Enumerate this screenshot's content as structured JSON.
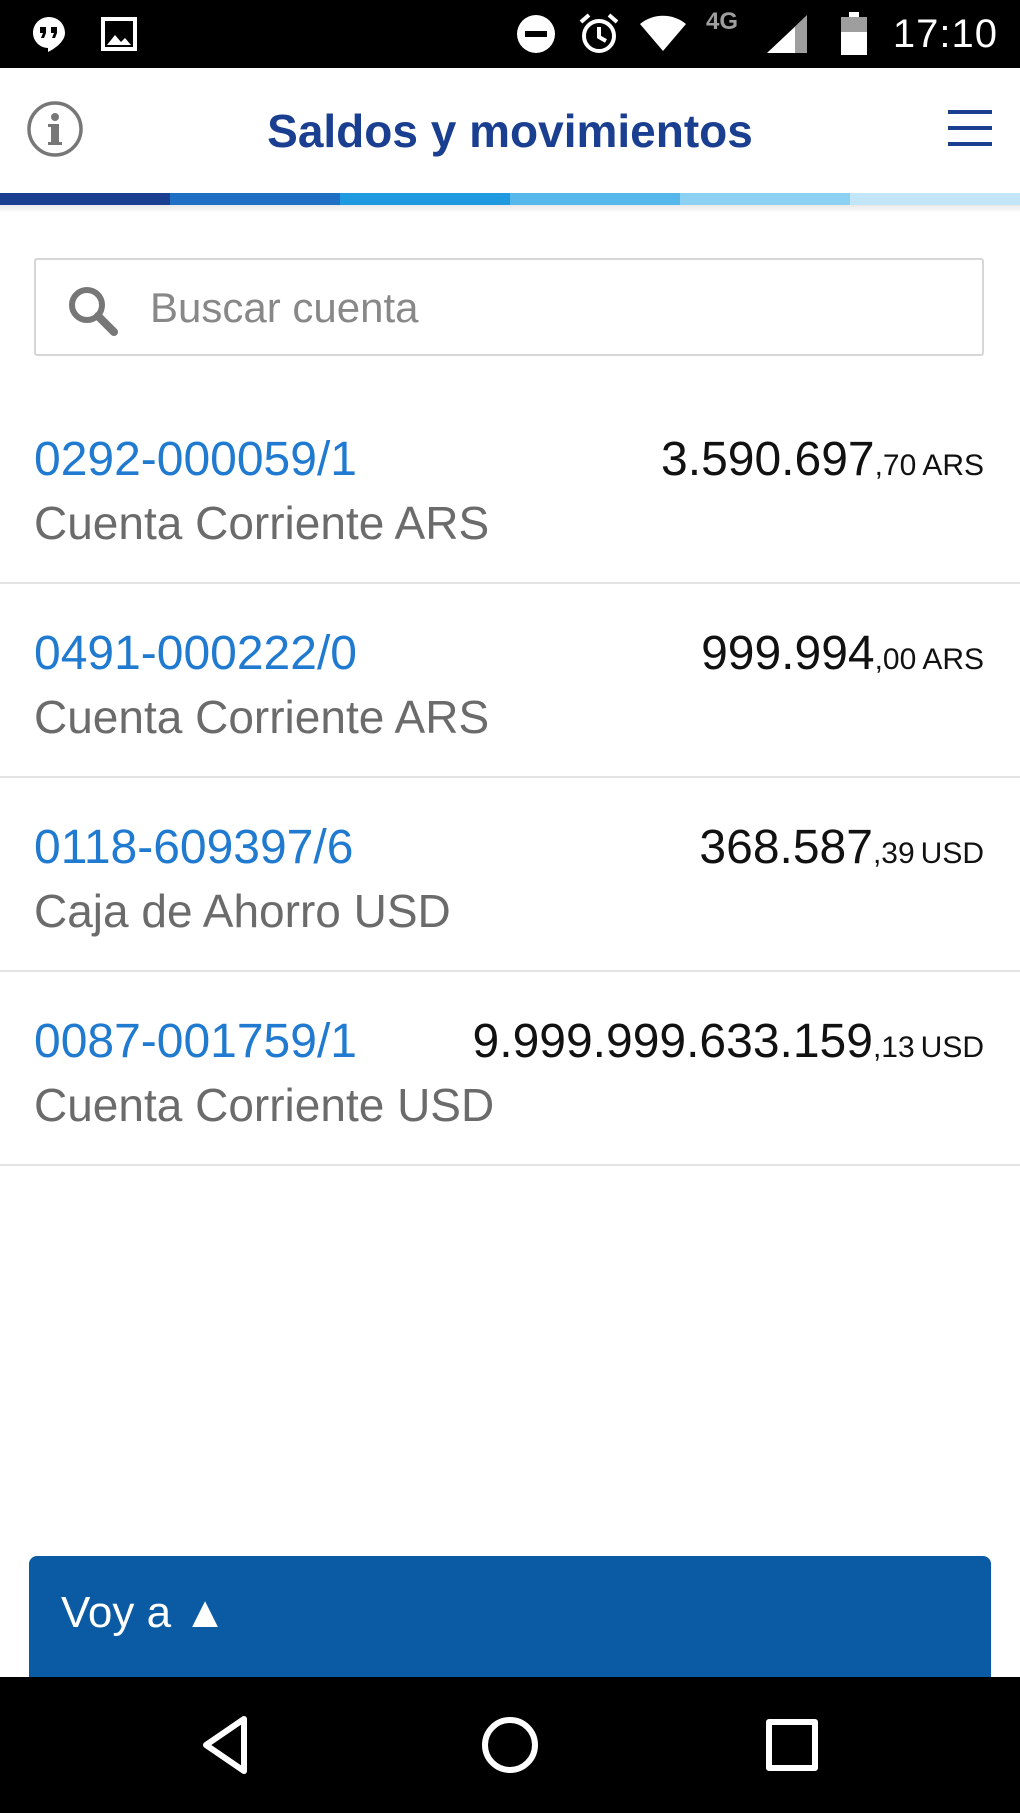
{
  "status_bar": {
    "time": "17:10",
    "network": "4G",
    "icons": [
      "hangouts-icon",
      "image-icon",
      "do-not-disturb-icon",
      "alarm-icon",
      "wifi-icon",
      "signal-icon",
      "battery-icon"
    ]
  },
  "header": {
    "title": "Saldos y movimientos",
    "info_icon": "info-icon",
    "menu_icon": "menu-icon",
    "stripe_colors": [
      "#1a3f91",
      "#1f6fc4",
      "#1f9ae0",
      "#55b7ea",
      "#8cd0f2",
      "#c2e6f8"
    ]
  },
  "search": {
    "placeholder": "Buscar cuenta",
    "value": ""
  },
  "accounts": [
    {
      "number": "0292-000059/1",
      "type": "Cuenta Corriente ARS",
      "amount_int": "3.590.697",
      "amount_dec": ",70",
      "currency": "ARS"
    },
    {
      "number": "0491-000222/0",
      "type": "Cuenta Corriente ARS",
      "amount_int": "999.994",
      "amount_dec": ",00",
      "currency": "ARS"
    },
    {
      "number": "0118-609397/6",
      "type": "Caja de Ahorro USD",
      "amount_int": "368.587",
      "amount_dec": ",39",
      "currency": "USD"
    },
    {
      "number": "0087-001759/1",
      "type": "Cuenta Corriente USD",
      "amount_int": "9.999.999.633.159",
      "amount_dec": ",13",
      "currency": "USD"
    }
  ],
  "voy_a": {
    "label": "Voy a ▲"
  },
  "nav": {
    "back": "back-icon",
    "home": "home-icon",
    "recents": "recents-icon"
  },
  "colors": {
    "brand_dark": "#1a3f91",
    "link": "#1f7ad0",
    "button_bg": "#0a5ba4"
  }
}
